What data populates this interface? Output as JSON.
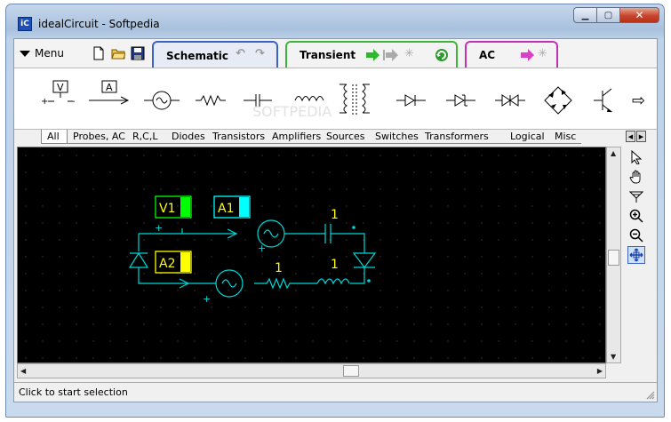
{
  "window": {
    "title": "idealCircuit - Softpedia",
    "app_icon_label": "iC"
  },
  "window_controls": {
    "minimize": "▁",
    "maximize": "▢",
    "close": "✕"
  },
  "toolbar": {
    "menu_label": "Menu"
  },
  "mode_tabs": [
    {
      "label": "Schematic",
      "color": "#3a63c4"
    },
    {
      "label": "Transient",
      "color": "#3fb43a"
    },
    {
      "label": "AC",
      "color": "#c032b8"
    }
  ],
  "palette": {
    "voltmeter_label": "V",
    "ammeter_label": "A",
    "next_arrow": "⇨"
  },
  "category_tabs": [
    "All",
    "Probes, AC",
    "R,C,L",
    "Diodes",
    "Transistors",
    "Amplifiers",
    "Sources",
    "Switches",
    "Transformers",
    "Logical",
    "Misc"
  ],
  "schematic": {
    "probe_v1": {
      "label": "V1",
      "color": "#00ff00"
    },
    "probe_a1": {
      "label": "A1",
      "color": "#00ffff"
    },
    "probe_a2": {
      "label": "A2",
      "color": "#ffff00"
    },
    "capacitor_value": "1",
    "resistor_value": "1",
    "inductor_value": "1",
    "plus_sign": "+",
    "wire_color": "#00d8d8"
  },
  "status": {
    "text": "Click to start selection"
  },
  "watermark": "SOFTPEDIA"
}
